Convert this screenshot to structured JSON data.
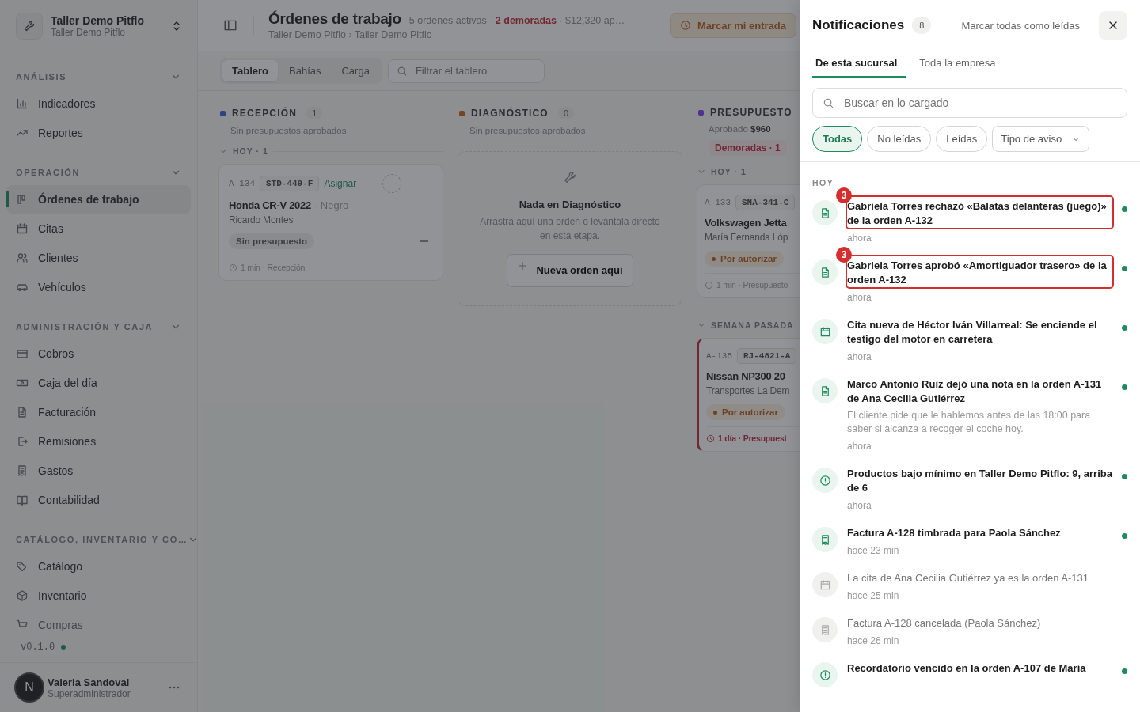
{
  "sidebar": {
    "workspace": {
      "title": "Taller Demo Pitflo",
      "subtitle": "Taller Demo Pitflo"
    },
    "sections": [
      {
        "title": "ANÁLISIS",
        "expanded": true,
        "items": [
          {
            "label": "Indicadores",
            "kind": "chart",
            "selected": false
          },
          {
            "label": "Reportes",
            "kind": "trend",
            "selected": false
          }
        ]
      },
      {
        "title": "OPERACIÓN",
        "expanded": true,
        "items": [
          {
            "label": "Órdenes de trabajo",
            "kind": "kanban",
            "selected": true
          },
          {
            "label": "Citas",
            "kind": "calendar",
            "selected": false
          },
          {
            "label": "Clientes",
            "kind": "users",
            "selected": false
          },
          {
            "label": "Vehículos",
            "kind": "car",
            "selected": false
          }
        ]
      },
      {
        "title": "ADMINISTRACIÓN Y CAJA",
        "expanded": true,
        "items": [
          {
            "label": "Cobros",
            "kind": "card",
            "selected": false
          },
          {
            "label": "Caja del día",
            "kind": "cash",
            "selected": false
          },
          {
            "label": "Facturación",
            "kind": "file",
            "selected": false
          },
          {
            "label": "Remisiones",
            "kind": "export",
            "selected": false
          },
          {
            "label": "Gastos",
            "kind": "receipt",
            "selected": false
          },
          {
            "label": "Contabilidad",
            "kind": "book",
            "selected": false
          }
        ]
      },
      {
        "title": "CATÁLOGO, INVENTARIO Y CO…",
        "expanded": true,
        "items": [
          {
            "label": "Catálogo",
            "kind": "tag",
            "selected": false
          },
          {
            "label": "Inventario",
            "kind": "box",
            "selected": false
          },
          {
            "label": "Compras",
            "kind": "cart",
            "selected": false
          }
        ]
      }
    ],
    "version": "v0.1.0",
    "user": {
      "initial": "N",
      "name": "Valeria Sandoval",
      "role": "Superadministrador"
    }
  },
  "header": {
    "title": "Órdenes de trabajo",
    "summary": "5 órdenes activas · ",
    "delayed": "2 demoradas",
    "amount": " · $12,320 ap…",
    "breadcrumb": "Taller Demo Pitflo › Taller Demo Pitflo",
    "action": "Marcar mi entrada"
  },
  "view_tabs": [
    {
      "label": "Tablero",
      "selected": true
    },
    {
      "label": "Bahías",
      "selected": false
    },
    {
      "label": "Carga",
      "selected": false
    }
  ],
  "filter": {
    "placeholder": "Filtrar el tablero"
  },
  "columns": [
    {
      "title": "RECEPCIÓN",
      "color": "#2f4284",
      "count": "1",
      "subtitle": "Sin presupuestos aprobados",
      "groups": [
        {
          "label": "HOY · 1",
          "cards": [
            {
              "id": "A-134",
              "plate": "STD-449-F",
              "assign": "Asignar",
              "vehicle": "Honda CR-V 2022",
              "paint": "· Negro",
              "customer": "Ricardo Montes",
              "status": {
                "label": "Sin presupuesto",
                "kind": "neutral"
              },
              "footer": "1 min · Recepción",
              "late": false
            }
          ]
        }
      ]
    },
    {
      "title": "DIAGNÓSTICO",
      "color": "#734523",
      "count": "0",
      "subtitle": "Sin presupuestos aprobados",
      "empty": {
        "title": "Nada en Diagnóstico",
        "text": "Arrastra aquí una orden o levántala directo en esta etapa.",
        "action": "Nueva orden aquí"
      }
    },
    {
      "title": "PRESUPUESTO",
      "color": "#50318d",
      "subtitle": "Aprobado **$960**",
      "delayed": "Demoradas · 1",
      "groups": [
        {
          "label": "HOY · 1",
          "cards": [
            {
              "id": "A-133",
              "plate": "SNA-341-C",
              "vehicle": "Volkswagen Jetta",
              "customer": "María Fernanda Lóp",
              "status": {
                "label": "Por autorizar",
                "kind": "pending"
              },
              "footer": "1 min · Presupuesto",
              "late": false
            }
          ]
        },
        {
          "label": "SEMANA PASADA",
          "cards": [
            {
              "id": "A-135",
              "plate": "RJ-4821-A",
              "vehicle": "Nissan NP300 20",
              "customer": "Transportes La Dem",
              "status": {
                "label": "Por autorizar",
                "kind": "pending"
              },
              "footer": "1 día · Presupuest",
              "late": true
            }
          ]
        }
      ]
    }
  ],
  "notifications": {
    "title": "Notificaciones",
    "count": "8",
    "mark_all": "Marcar todas como leídas",
    "tabs": [
      {
        "label": "De esta sucursal",
        "selected": true
      },
      {
        "label": "Toda la empresa",
        "selected": false
      }
    ],
    "search": {
      "placeholder": "Buscar en lo cargado"
    },
    "filters": [
      {
        "label": "Todas",
        "selected": true
      },
      {
        "label": "No leídas",
        "selected": false
      },
      {
        "label": "Leídas",
        "selected": false
      }
    ],
    "type_filter": "Tipo de aviso",
    "group": "HOY",
    "items": [
      {
        "kind": "document",
        "title": "Gabriela Torres rechazó «Balatas delanteras (juego)» de la orden A-132",
        "time": "ahora",
        "unread": true,
        "flag": "3"
      },
      {
        "kind": "document",
        "title": "Gabriela Torres aprobó «Amortiguador trasero» de la orden A-132",
        "time": "ahora",
        "unread": true,
        "flag": "3"
      },
      {
        "kind": "calendar",
        "title": "Cita nueva de Héctor Iván Villarreal: Se enciende el testigo del motor en carretera",
        "time": "ahora",
        "unread": true
      },
      {
        "kind": "document",
        "title": "Marco Antonio Ruiz dejó una nota en la orden A-131 de Ana Cecilia Gutiérrez",
        "body": "El cliente pide que le hablemos antes de las 18:00 para saber si alcanza a recoger el coche hoy.",
        "time": "ahora",
        "unread": true
      },
      {
        "kind": "alert",
        "title": "Productos bajo mínimo en Taller Demo Pitflo: 9, arriba de 6",
        "time": "ahora",
        "unread": true
      },
      {
        "kind": "receipt",
        "title": "Factura A-128 timbrada para Paola Sánchez",
        "time": "hace 23 min",
        "unread": true
      },
      {
        "kind": "calendar",
        "title": "La cita de Ana Cecilia Gutiérrez ya es la orden A-131",
        "time": "hace 25 min",
        "unread": false
      },
      {
        "kind": "receipt",
        "title": "Factura A-128 cancelada (Paola Sánchez)",
        "time": "hace 26 min",
        "unread": false
      },
      {
        "kind": "alert",
        "title": "Recordatorio vencido en la orden A-107 de María",
        "unread": true
      }
    ]
  }
}
